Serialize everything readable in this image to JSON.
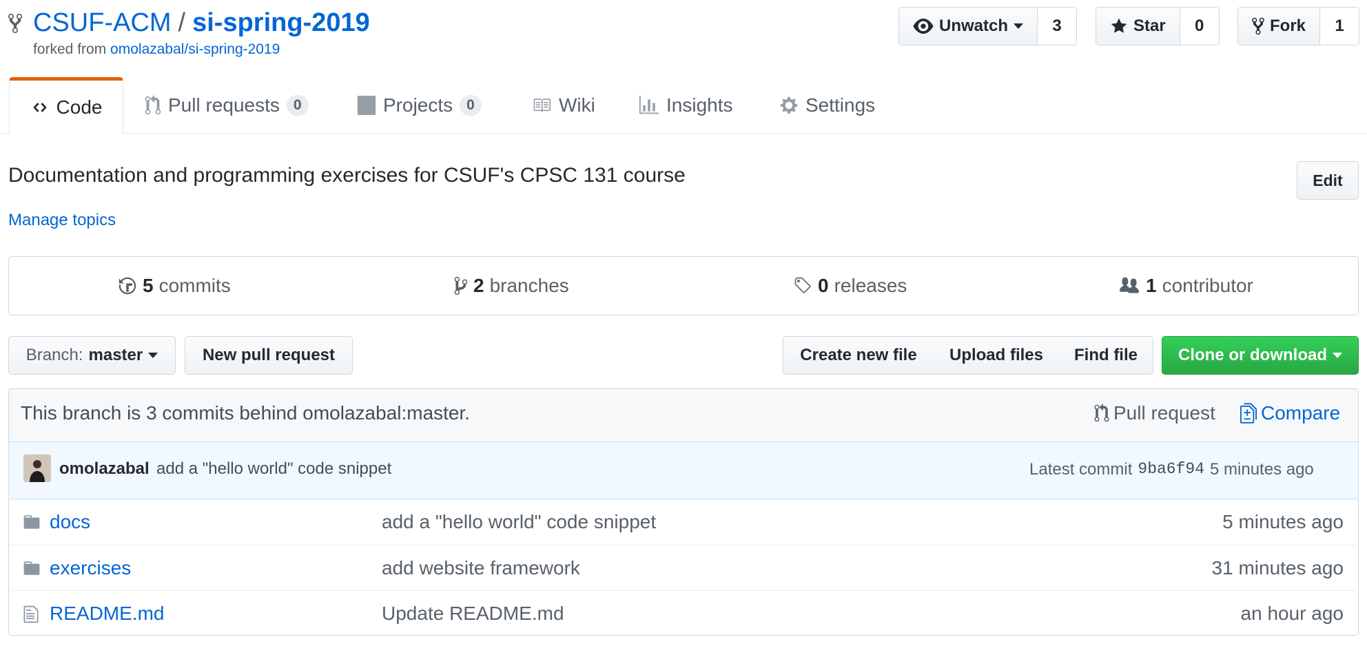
{
  "repo": {
    "owner": "CSUF-ACM",
    "separator": "/",
    "name": "si-spring-2019",
    "forked_prefix": "forked from",
    "forked_source": "omolazabal/si-spring-2019"
  },
  "actions": {
    "watch": {
      "label": "Unwatch",
      "count": "3"
    },
    "star": {
      "label": "Star",
      "count": "0"
    },
    "fork": {
      "label": "Fork",
      "count": "1"
    }
  },
  "tabs": [
    {
      "label": "Code",
      "icon": "code-icon"
    },
    {
      "label": "Pull requests",
      "count": "0",
      "icon": "pull-request-icon"
    },
    {
      "label": "Projects",
      "count": "0",
      "icon": "project-icon"
    },
    {
      "label": "Wiki",
      "icon": "book-icon"
    },
    {
      "label": "Insights",
      "icon": "graph-icon"
    },
    {
      "label": "Settings",
      "icon": "gear-icon"
    }
  ],
  "about": {
    "description": "Documentation and programming exercises for CSUF's CPSC 131 course",
    "edit_label": "Edit",
    "manage_topics": "Manage topics"
  },
  "summary": {
    "commits": {
      "num": "5",
      "label": "commits"
    },
    "branches": {
      "num": "2",
      "label": "branches"
    },
    "releases": {
      "num": "0",
      "label": "releases"
    },
    "contributors": {
      "num": "1",
      "label": "contributor"
    }
  },
  "toolbar": {
    "branch_prefix": "Branch:",
    "branch_name": "master",
    "new_pr": "New pull request",
    "create_file": "Create new file",
    "upload": "Upload files",
    "find": "Find file",
    "clone": "Clone or download"
  },
  "behind": {
    "text": "This branch is 3 commits behind omolazabal:master.",
    "pull_request": "Pull request",
    "compare": "Compare"
  },
  "latest_commit": {
    "author": "omolazabal",
    "message": "add a \"hello world\" code snippet",
    "prefix": "Latest commit",
    "sha": "9ba6f94",
    "age": "5 minutes ago"
  },
  "files": [
    {
      "name": "docs",
      "type": "folder",
      "message": "add a \"hello world\" code snippet",
      "age": "5 minutes ago"
    },
    {
      "name": "exercises",
      "type": "folder",
      "message": "add website framework",
      "age": "31 minutes ago"
    },
    {
      "name": "README.md",
      "type": "file",
      "message": "Update README.md",
      "age": "an hour ago"
    }
  ],
  "colors": {
    "link": "#0366d6",
    "tab_accent": "#e36209",
    "clone_green": "#28a745"
  }
}
